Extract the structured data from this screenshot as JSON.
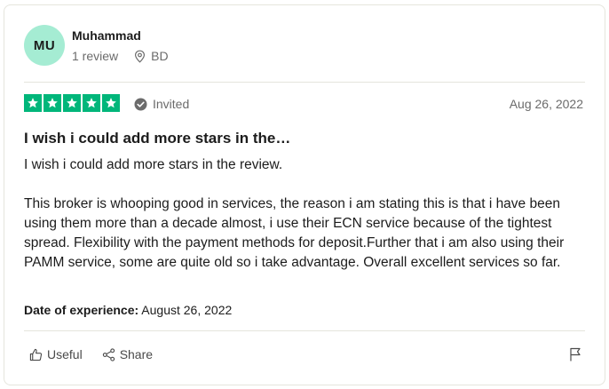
{
  "reviewer": {
    "initials": "MU",
    "name": "Muhammad",
    "review_count": "1 review",
    "location": "BD",
    "avatar_color": "#a5ecd3"
  },
  "rating": {
    "stars": 5,
    "max": 5,
    "color": "#00b67a",
    "badge_label": "Invited",
    "badge_icon": "check-circle-icon"
  },
  "review": {
    "date": "Aug 26, 2022",
    "title": "I wish i could add more stars in the…",
    "paragraphs": [
      "I wish i could add more stars in the review.",
      "This broker is whooping good in services, the reason i am stating this is that i have been using them more than a decade almost, i use their ECN service because of the tightest spread. Flexibility with the payment methods for deposit.Further that i am also using their PAMM service, some are quite old so i take advantage. Overall excellent services so far."
    ],
    "experience_label": "Date of experience:",
    "experience_date": "August 26, 2022"
  },
  "actions": {
    "useful_label": "Useful",
    "useful_icon": "thumbs-up-icon",
    "share_label": "Share",
    "share_icon": "share-icon",
    "flag_icon": "flag-icon"
  }
}
